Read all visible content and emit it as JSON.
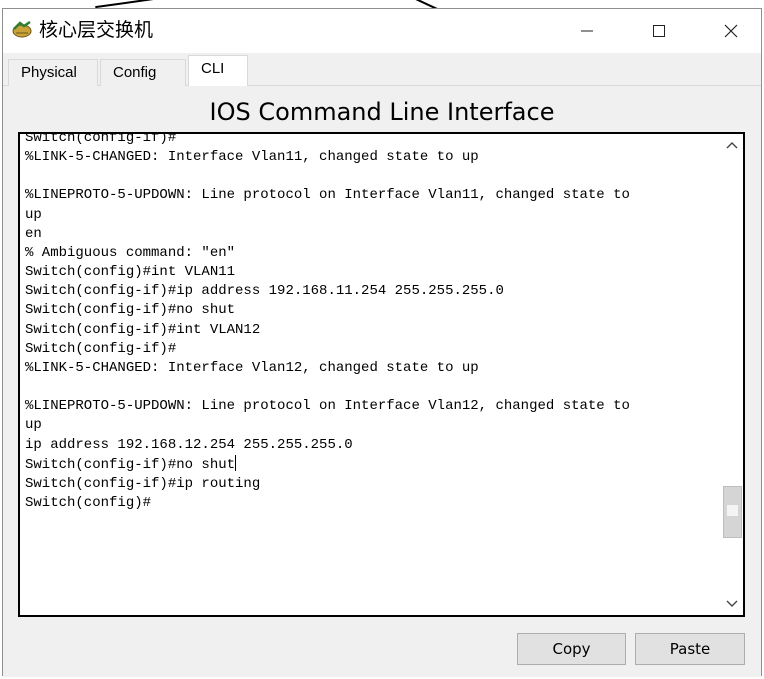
{
  "window": {
    "title": "核心层交换机",
    "icon": "packet-tracer-switch-icon",
    "controls": [
      "minimize",
      "maximize",
      "close"
    ]
  },
  "tabs": [
    {
      "label": "Physical",
      "active": false
    },
    {
      "label": "Config",
      "active": false
    },
    {
      "label": "CLI",
      "active": true
    }
  ],
  "cli": {
    "heading": "IOS Command Line Interface",
    "lines": [
      "Switch(config-if)#",
      "%LINK-5-CHANGED: Interface Vlan11, changed state to up",
      "",
      "%LINEPROTO-5-UPDOWN: Line protocol on Interface Vlan11, changed state to",
      "up",
      "en",
      "% Ambiguous command: \"en\"",
      "Switch(config)#int VLAN11",
      "Switch(config-if)#ip address 192.168.11.254 255.255.255.0",
      "Switch(config-if)#no shut",
      "Switch(config-if)#int VLAN12",
      "Switch(config-if)#",
      "%LINK-5-CHANGED: Interface Vlan12, changed state to up",
      "",
      "%LINEPROTO-5-UPDOWN: Line protocol on Interface Vlan12, changed state to",
      "up",
      "ip address 192.168.12.254 255.255.255.0",
      "Switch(config-if)#no shut",
      "Switch(config-if)#ip routing",
      "Switch(config)#"
    ],
    "caret_after_line": 17
  },
  "buttons": {
    "copy": "Copy",
    "paste": "Paste"
  }
}
